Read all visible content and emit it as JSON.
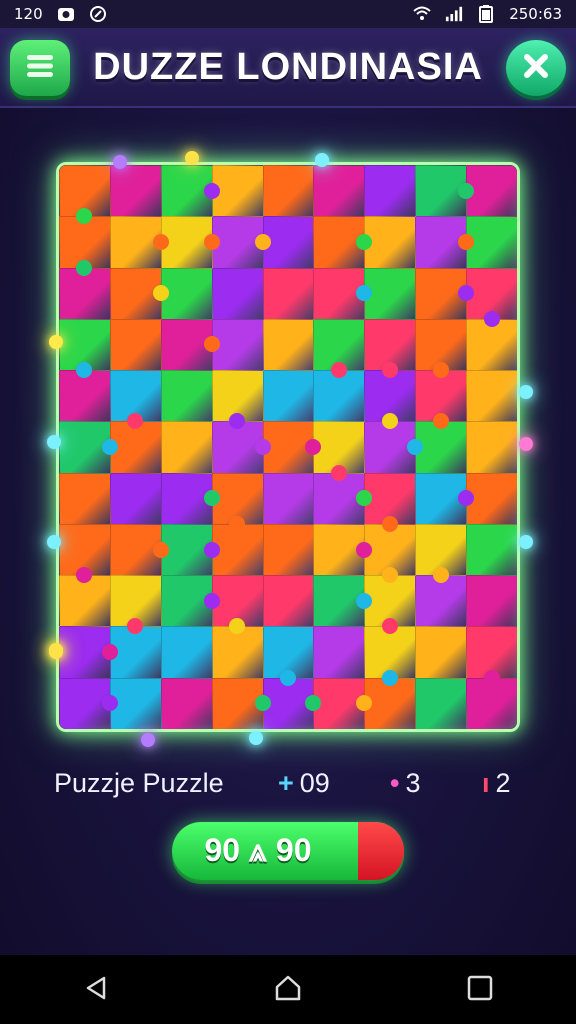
{
  "status_bar": {
    "left_text": "120",
    "time": "250:63"
  },
  "header": {
    "title": "DUZZE LONDINASIA",
    "menu_icon": "menu-icon",
    "close_icon": "close-icon"
  },
  "colors": {
    "accent_green": "#3ddc5c",
    "board_glow": "#7cff8a",
    "progress_red": "#e01e2e",
    "background": "#1a1440"
  },
  "stats": {
    "label": "Puzzje Puzzle",
    "items": [
      {
        "icon": "+",
        "value": "09",
        "color": "#5ad4ff"
      },
      {
        "icon": "•",
        "value": "3",
        "color": "#ff5ac8"
      },
      {
        "icon": "ı",
        "value": "2",
        "color": "#ff4a6a"
      }
    ]
  },
  "progress": {
    "text": "90 ⩓ 90",
    "fraction": 0.8
  },
  "navigation": {
    "back_icon": "back-icon",
    "home_icon": "home-icon",
    "recents_icon": "recents-icon"
  }
}
